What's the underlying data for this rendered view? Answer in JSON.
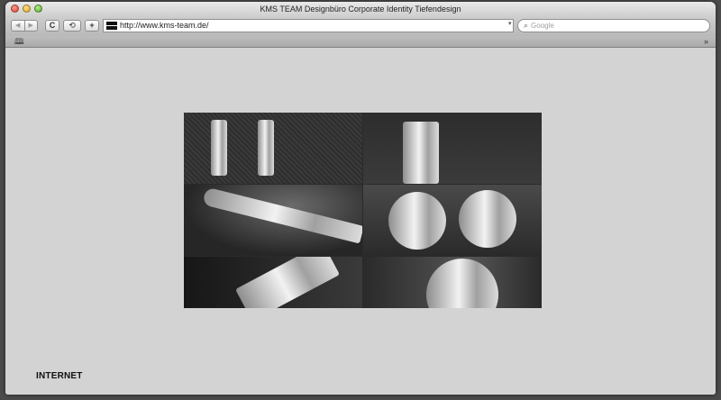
{
  "window": {
    "title": "KMS TEAM Designbüro Corporate Identity Tiefendesign"
  },
  "toolbar": {
    "back_glyph": "◀",
    "forward_glyph": "▶",
    "reload_glyph": "C",
    "snapback_glyph": "⟲",
    "add_bookmark_glyph": "+",
    "url": "http://www.kms-team.de/",
    "search_placeholder": "Google",
    "search_icon": "magnifier-icon"
  },
  "bookmarks_bar": {
    "book_glyph": "🕮",
    "overflow_glyph": "»"
  },
  "page": {
    "footer_label": "INTERNET"
  },
  "colors": {
    "page_background": "#d3d3d3",
    "collage_dark": "#2a2a2a"
  }
}
